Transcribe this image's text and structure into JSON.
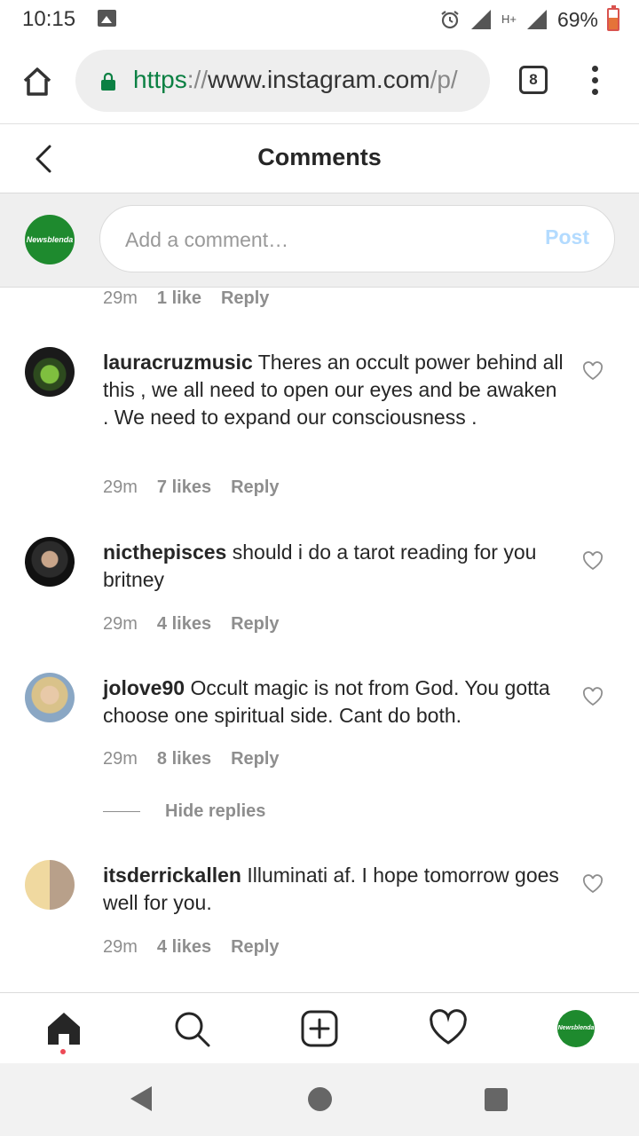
{
  "status_bar": {
    "time": "10:15",
    "network_label": "H+",
    "battery_percent": "69%"
  },
  "browser": {
    "url_scheme": "https",
    "url_separator": "://",
    "url_host": "www.instagram.com",
    "url_path": "/p/",
    "tab_count": "8"
  },
  "header": {
    "title": "Comments"
  },
  "add_comment": {
    "placeholder": "Add a comment…",
    "post_label": "Post",
    "avatar_label": "Newsblenda"
  },
  "partial_comment": {
    "time": "29m",
    "likes": "1 like",
    "reply": "Reply"
  },
  "comments": [
    {
      "username": "lauracruzmusic",
      "text": "Theres an occult power behind all this , we all need to open our eyes and be awaken . We need to expand our consciousness .",
      "time": "29m",
      "likes": "7 likes",
      "reply": "Reply"
    },
    {
      "username": "nicthepisces",
      "text": "should i do a tarot reading for you britney",
      "time": "29m",
      "likes": "4 likes",
      "reply": "Reply"
    },
    {
      "username": "jolove90",
      "text": "Occult magic is not from God. You gotta choose one spiritual side. Cant do both.",
      "time": "29m",
      "likes": "8 likes",
      "reply": "Reply"
    },
    {
      "username": "itsderrickallen",
      "text": "Illuminati af. I hope tomorrow goes well for you.",
      "time": "29m",
      "likes": "4 likes",
      "reply": "Reply"
    }
  ],
  "hide_replies_label": "Hide replies",
  "bottom_nav": {
    "items": [
      "home-icon",
      "search-icon",
      "add-post-icon",
      "activity-heart-icon",
      "profile-avatar"
    ],
    "avatar_label": "Newsblenda"
  },
  "colors": {
    "url_scheme": "#0b8043",
    "post_disabled": "#b3dbff",
    "meta_grey": "#8e8e8e",
    "brand_green": "#1e8a2e",
    "notification_dot": "#ed4956"
  }
}
